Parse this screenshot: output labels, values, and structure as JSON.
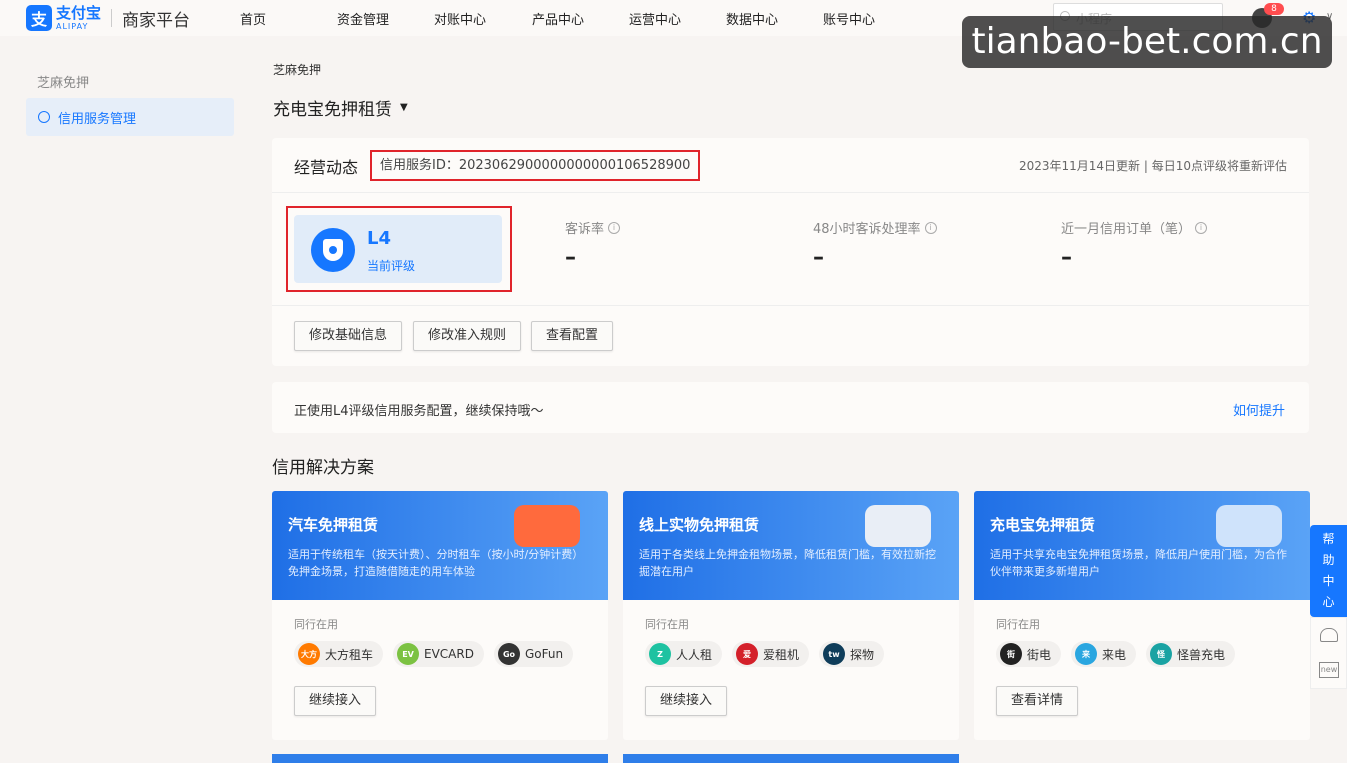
{
  "header": {
    "logo_cn": "支付宝",
    "logo_en": "ALIPAY",
    "platform": "商家平台",
    "nav": [
      "首页",
      "资金管理",
      "对账中心",
      "产品中心",
      "运营中心",
      "数据中心",
      "账号中心"
    ],
    "search_placeholder": "小程序",
    "notification_count": "8"
  },
  "watermark": "tianbao-bet.com.cn",
  "sidebar": {
    "group": "芝麻免押",
    "items": [
      {
        "label": "信用服务管理"
      }
    ]
  },
  "main": {
    "breadcrumb": "芝麻免押",
    "title": "充电宝免押租赁",
    "card": {
      "title": "经营动态",
      "service_id": "信用服务ID：2023062900000000000106528900",
      "update_note": "2023年11月14日更新 | 每日10点评级将重新评估",
      "level": {
        "value": "L4",
        "label": "当前评级"
      },
      "metrics": [
        {
          "label": "客诉率",
          "value": "–"
        },
        {
          "label": "48小时客诉处理率",
          "value": "–"
        },
        {
          "label": "近一月信用订单（笔）",
          "value": "–"
        }
      ],
      "buttons": [
        "修改基础信息",
        "修改准入规则",
        "查看配置"
      ]
    },
    "notice": {
      "text": "正使用L4评级信用服务配置，继续保持哦～",
      "link": "如何提升"
    },
    "solutions_title": "信用解决方案",
    "solutions": [
      {
        "title": "汽车免押租赁",
        "desc": "适用于传统租车（按天计费）、分时租车（按小时/分钟计费）免押金场景，打造随借随走的用车体验",
        "peer_label": "同行在用",
        "peers": [
          {
            "name": "大方租车",
            "logo": "大方",
            "color": "#ff7a00"
          },
          {
            "name": "EVCARD",
            "logo": "EV",
            "color": "#7cc242"
          },
          {
            "name": "GoFun",
            "logo": "Go",
            "color": "#333333"
          }
        ],
        "button": "继续接入"
      },
      {
        "title": "线上实物免押租赁",
        "desc": "适用于各类线上免押金租物场景，降低租赁门槛，有效拉新挖掘潜在用户",
        "peer_label": "同行在用",
        "peers": [
          {
            "name": "人人租",
            "logo": "Z",
            "color": "#1ec2a1"
          },
          {
            "name": "爱租机",
            "logo": "爱",
            "color": "#d4202a"
          },
          {
            "name": "探物",
            "logo": "tw",
            "color": "#0f3d5a"
          }
        ],
        "button": "继续接入"
      },
      {
        "title": "充电宝免押租赁",
        "desc": "适用于共享充电宝免押租赁场景，降低用户使用门槛，为合作伙伴带来更多新增用户",
        "peer_label": "同行在用",
        "peers": [
          {
            "name": "街电",
            "logo": "街",
            "color": "#222222"
          },
          {
            "name": "来电",
            "logo": "来",
            "color": "#2aa6e0"
          },
          {
            "name": "怪兽充电",
            "logo": "怪",
            "color": "#1aa3a3"
          }
        ],
        "button": "查看详情"
      }
    ]
  },
  "help": {
    "label": "帮助中心",
    "new_label": "new"
  }
}
